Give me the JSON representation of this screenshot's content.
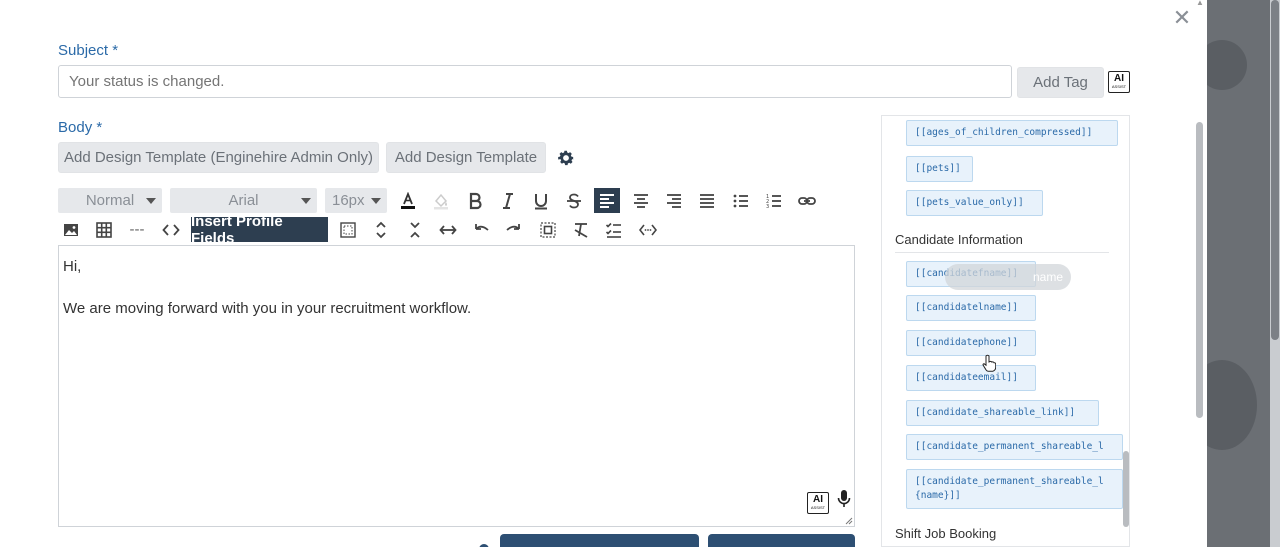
{
  "subject": {
    "label": "Subject",
    "required_mark": "*",
    "placeholder": "Your status is changed.",
    "add_tag_label": "Add Tag"
  },
  "ai_badge": {
    "title": "AI",
    "sub": "ASSIST"
  },
  "body": {
    "label": "Body",
    "required_mark": "*",
    "add_design_template_admin": "Add Design Template (Enginehire Admin Only)",
    "add_design_template": "Add Design Template"
  },
  "toolbar": {
    "format_value": "Normal",
    "font_value": "Arial",
    "size_value": "16px",
    "hr_label": "---",
    "insert_profile_fields": "Insert Profile Fields"
  },
  "editor": {
    "line1": "Hi,",
    "line2": "We are moving forward with you in your recruitment workflow."
  },
  "panel": {
    "top_tags": [
      "[[ages_of_children_compressed]]",
      "[[pets]]",
      "[[pets_value_only]]"
    ],
    "candidate_section": "Candidate Information",
    "candidate_tags": [
      "[[candidatefname]]",
      "[[candidatelname]]",
      "[[candidatephone]]",
      "[[candidateemail]]",
      "[[candidate_shareable_link]]",
      "[[candidate_permanent_shareable_l",
      "[[candidate_permanent_shareable_l\n{name}]]"
    ],
    "tooltip_text": "name",
    "shift_section": "Shift Job Booking"
  },
  "colors": {
    "accent": "#2b6aa8",
    "toolbar_dark": "#2d3e50",
    "tag_bg": "#e8f2fb"
  }
}
